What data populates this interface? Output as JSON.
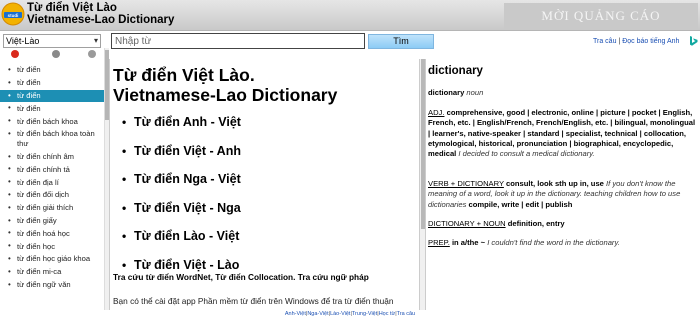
{
  "header": {
    "title": "Từ điển Việt Lào",
    "subtitle": "Vietnamese-Lao Dictionary",
    "ad": "MỜI QUẢNG CÁO",
    "logo_icon": "studydict-logo-icon"
  },
  "toolbar": {
    "language": "Việt-Lào",
    "search_placeholder": "Nhập từ",
    "search_value": "",
    "search_button": "Tìm",
    "link_translate": "Tra câu",
    "link_separator": "|",
    "link_news": "Đọc báo tiếng Anh"
  },
  "sidebar": {
    "items": [
      "từ điển",
      "từ điển",
      "từ điển",
      "từ điển",
      "từ điển bách khoa",
      "từ điển bách khoa toàn thư",
      "từ điển chính âm",
      "từ điển chính tả",
      "từ điển địa lí",
      "từ điển đối dịch",
      "từ điển giải thích",
      "từ điển giấy",
      "từ điển hoá học",
      "từ điển học",
      "từ điển học giáo khoa",
      "từ điển mi-ca",
      "từ điển ngữ văn"
    ],
    "active_index": 2
  },
  "main": {
    "title": "Từ điển Việt Lào.",
    "subtitle": "Vietnamese-Lao Dictionary",
    "dictionaries": [
      "Từ điển Anh - Việt",
      "Từ điển Việt - Anh",
      "Từ điển Nga - Việt",
      "Từ điển Việt - Nga",
      "Từ điển Lào - Việt",
      "Từ điển Việt - Lào"
    ],
    "note": "Tra cứu từ điển WordNet, Từ điển Collocation. Tra cứu ngữ pháp",
    "note2": "Bạn có thể cài đặt app Phần mềm từ điển trên Windows để tra từ điển thuận"
  },
  "entry": {
    "word": "dictionary",
    "headword": "dictionary",
    "pos": "noun",
    "adj_label": "ADJ.",
    "adj_text": "comprehensive, good | electronic, online | picture | pocket | English, French, etc. | English/French, French/English, etc. | bilingual, monolingual | learner's, native-speaker | standard | specialist, technical | collocation, etymological, historical, pronunciation | biographical, encyclopedic, medical",
    "adj_example": "I decided to consult a medical dictionary.",
    "verb_label": "VERB + DICTIONARY",
    "verb_text": "consult, look sth up in, use",
    "verb_example": "If you don't know the meaning of a word, look it up in the dictionary. teaching children how to use dictionaries",
    "verb_text2": "compile, write | edit | publish",
    "noun_label": "DICTIONARY + NOUN",
    "noun_text": "definition, entry",
    "prep_label": "PREP.",
    "prep_text": "in a/the ~",
    "prep_example": "I couldn't find the word in the dictionary."
  },
  "footer": {
    "links": [
      "Anh-Việt",
      "Nga-Việt",
      "Lào-Việt",
      "Trung-Việt",
      "Học từ",
      "Tra câu"
    ],
    "separator": "|"
  },
  "colors": {
    "active_sidebar": "#1d8fb4",
    "link": "#1a4fb3",
    "search_button": "#8ccbf5"
  }
}
